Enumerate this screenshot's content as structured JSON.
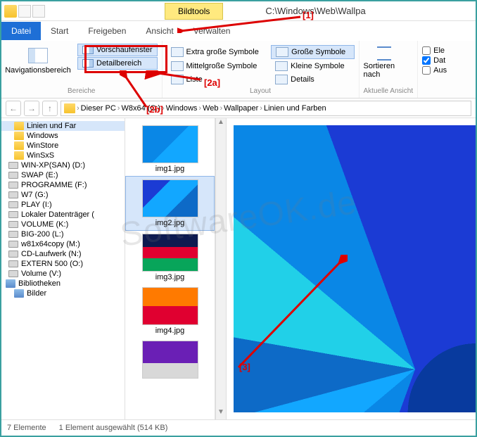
{
  "titlebar": {
    "tool_tab": "Bildtools",
    "title_path": "C:\\Windows\\Web\\Wallpa"
  },
  "menu": {
    "datei": "Datei",
    "start": "Start",
    "freigeben": "Freigeben",
    "ansicht": "Ansicht",
    "verwalten": "Verwalten"
  },
  "ribbon": {
    "nav_label": "Navigationsbereich",
    "group_bereiche": "Bereiche",
    "vorschau": "Vorschaufenster",
    "detail": "Detailbereich",
    "extra_gross": "Extra große Symbole",
    "gross": "Große Symbole",
    "mittel": "Mittelgroße Symbole",
    "klein": "Kleine Symbole",
    "liste": "Liste",
    "details": "Details",
    "group_layout": "Layout",
    "sort": "Sortieren nach",
    "group_ansicht": "Aktuelle Ansicht",
    "opt_el": "Ele",
    "opt_dat": "Dat",
    "opt_aus": "Aus"
  },
  "breadcrumb": {
    "pc": "Dieser PC",
    "drive": "W8x64 (C:)",
    "p1": "Windows",
    "p2": "Web",
    "p3": "Wallpaper",
    "p4": "Linien und Farben"
  },
  "tree": {
    "n0": "Linien und Far",
    "n1": "Windows",
    "n2": "WinStore",
    "n3": "WinSxS",
    "d0": "WIN-XP(SAN) (D:)",
    "d1": "SWAP (E:)",
    "d2": "PROGRAMME (F:)",
    "d3": "W7 (G:)",
    "d4": "PLAY (I:)",
    "d5": "Lokaler Datenträger (",
    "d6": "VOLUME (K:)",
    "d7": "BIG-200 (L:)",
    "d8": "w81x64copy (M:)",
    "d9": "CD-Laufwerk (N:)",
    "d10": "EXTERN 500 (O:)",
    "d11": "Volume (V:)",
    "lib": "Bibliotheken",
    "lib0": "Bilder"
  },
  "files": {
    "f1": "img1.jpg",
    "f2": "img2.jpg",
    "f3": "img3.jpg",
    "f4": "img4.jpg"
  },
  "status": {
    "count": "7 Elemente",
    "sel": "1 Element ausgewählt (514 KB)"
  },
  "annot": {
    "a1": "[1]",
    "a2a": "[2a]",
    "a2b": "[2b]",
    "a3": "[3]"
  },
  "watermark": "SoftwareOK.de"
}
